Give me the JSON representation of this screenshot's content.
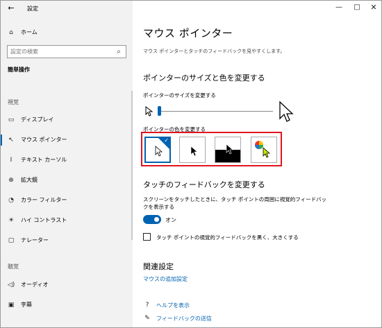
{
  "window": {
    "app_title": "設定",
    "minimize": "—",
    "maximize": "□",
    "close": "✕"
  },
  "sidebar": {
    "home": "ホーム",
    "search_placeholder": "設定の検索",
    "section": "簡単操作",
    "heading_vision": "視覚",
    "heading_hearing": "聴覚",
    "items": [
      {
        "label": "ディスプレイ",
        "icon": "display-icon"
      },
      {
        "label": "マウス ポインター",
        "icon": "mouse-pointer-icon",
        "active": true
      },
      {
        "label": "テキスト カーソル",
        "icon": "text-cursor-icon"
      },
      {
        "label": "拡大鏡",
        "icon": "magnifier-icon"
      },
      {
        "label": "カラー フィルター",
        "icon": "color-filter-icon"
      },
      {
        "label": "ハイ コントラスト",
        "icon": "high-contrast-icon"
      },
      {
        "label": "ナレーター",
        "icon": "narrator-icon"
      },
      {
        "label": "オーディオ",
        "icon": "audio-icon"
      },
      {
        "label": "字幕",
        "icon": "captions-icon"
      }
    ]
  },
  "main": {
    "title": "マウス ポインター",
    "subtitle": "マウス ポインターとタッチのフィードバックを見やすくします。",
    "pointer_section": "ポインターのサイズと色を変更する",
    "size_label": "ポインターのサイズを変更する",
    "size_value": 0.02,
    "color_label": "ポインターの色を変更する",
    "color_options": [
      "white",
      "black",
      "inverted",
      "custom"
    ],
    "selected_color": "white",
    "touch_section": "タッチのフィードバックを変更する",
    "touch_desc": "スクリーンをタッチしたときに、タッチ ポイントの周囲に視覚的フィードバックを表示する",
    "toggle_state": "オン",
    "checkbox_label": "タッチ ポイントの視覚的フィードバックを黒く、大きくする",
    "related_title": "関連設定",
    "related_link": "マウスの追加設定",
    "help_link": "ヘルプを表示",
    "feedback_link": "フィードバックの送信"
  },
  "colors": {
    "accent": "#0063b1",
    "highlight": "#e1141b",
    "sidebar_bg": "#f2f2f2"
  }
}
